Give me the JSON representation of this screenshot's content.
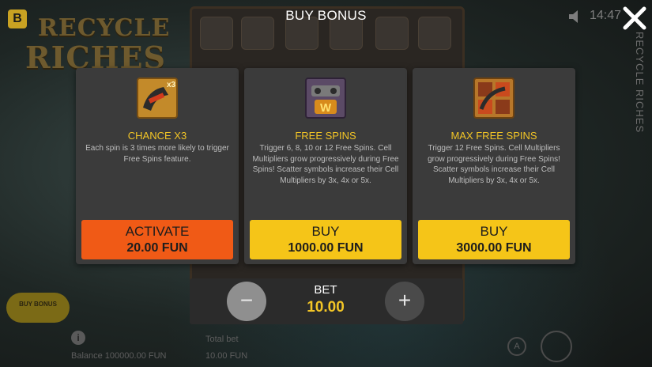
{
  "popup": {
    "title": "BUY BONUS"
  },
  "options": [
    {
      "title": "CHANCE X3",
      "description": "Each spin is 3 times more likely to trigger Free Spins feature.",
      "button_label": "ACTIVATE",
      "price": "20.00 FUN",
      "button_color": "#f05a16",
      "icon": "chance-x3-icon"
    },
    {
      "title": "FREE SPINS",
      "description": "Trigger 6, 8, 10 or 12 Free Spins. Cell Multipliers grow progressively during Free Spins! Scatter symbols increase their Cell Multipliers by 3x, 4x or 5x.",
      "button_label": "BUY",
      "price": "1000.00 FUN",
      "button_color": "#f5c518",
      "icon": "free-spins-icon"
    },
    {
      "title": "MAX FREE SPINS",
      "description": "Trigger 12 Free Spins. Cell Multipliers grow progressively during Free Spins! Scatter symbols increase their Cell Multipliers by 3x, 4x or 5x.",
      "button_label": "BUY",
      "price": "3000.00 FUN",
      "button_color": "#f5c518",
      "icon": "max-free-spins-icon"
    }
  ],
  "bet": {
    "label": "BET",
    "value": "10.00",
    "minus": "−",
    "plus": "+"
  },
  "background": {
    "logo_line1": "RECYCLE",
    "logo_line2": "RICHES",
    "side_title": "RECYCLE RICHES",
    "badge": "B",
    "clock": "14:47",
    "buy_bonus_chip": "BUY BONUS",
    "balance": "Balance 100000.00 FUN",
    "total_bet_label": "Total bet",
    "total_bet_value": "10.00 FUN",
    "auto_label": "A"
  },
  "colors": {
    "accent_yellow": "#f2c526",
    "activate_orange": "#f05a16",
    "card_bg": "#3b3b3b"
  }
}
